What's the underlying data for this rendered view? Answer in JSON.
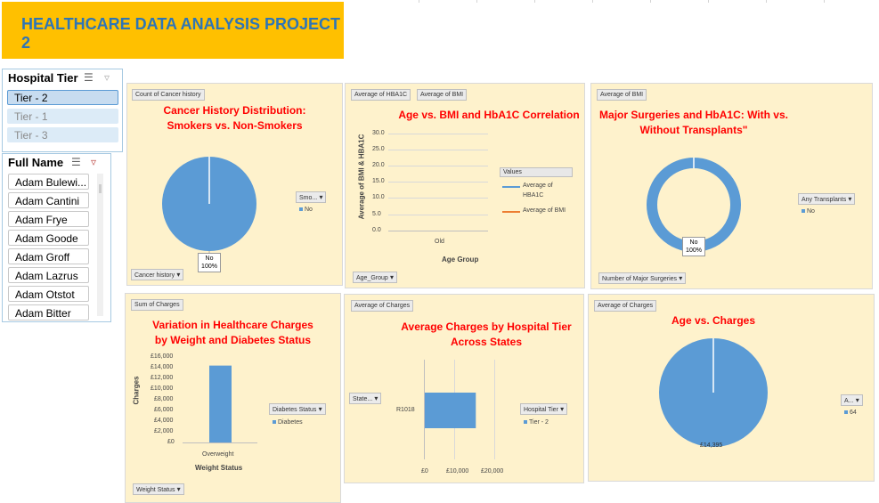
{
  "header": {
    "title": "HEALTHCARE DATA ANALYSIS PROJECT 2"
  },
  "hospital_tier_slicer": {
    "title": "Hospital Tier",
    "items": [
      "Tier - 2",
      "Tier - 1",
      "Tier - 3"
    ],
    "selected": "Tier - 2"
  },
  "full_name_slicer": {
    "title": "Full Name",
    "items": [
      "Adam Bulewi...",
      "Adam Cantini",
      "Adam Frye",
      "Adam Goode",
      "Adam Groff",
      "Adam Lazrus",
      "Adam Otstot",
      "Adam Bitter"
    ]
  },
  "charts": {
    "cancer": {
      "field_button": "Count of Cancer history",
      "title_line1": "Cancer History Distribution:",
      "title_line2": "Smokers vs. Non-Smokers",
      "legend_title": "Smo...",
      "legend_item": "No",
      "data_label_name": "No",
      "data_label_pct": "100%",
      "axis_button": "Cancer history"
    },
    "age_bmi": {
      "field_button_1": "Average of HBA1C",
      "field_button_2": "Average of BMI",
      "title": "Age vs. BMI and HbA1C Correlation",
      "y_axis_title": "Average of BMI & HBA1C",
      "y_ticks": [
        "30.0",
        "25.0",
        "20.0",
        "15.0",
        "10.0",
        "5.0",
        "0.0"
      ],
      "x_tick": "Old",
      "x_axis_title": "Age Group",
      "legend_title": "Values",
      "legend_item_1a": "Average of",
      "legend_item_1b": "HBA1C",
      "legend_item_2": "Average of BMI",
      "axis_button": "Age_Group"
    },
    "surgeries": {
      "field_button": "Average of BMI",
      "title_line1": "Major Surgeries and HbA1C: With vs.",
      "title_line2": "Without Transplants\"",
      "legend_title": "Any Transplants",
      "legend_item": "No",
      "data_label_name": "No",
      "data_label_pct": "100%",
      "axis_button": "Number of Major Surgeries"
    },
    "charges_weight": {
      "field_button": "Sum of Charges",
      "title_line1": "Variation in Healthcare Charges",
      "title_line2": "by Weight and Diabetes Status",
      "y_axis_title": "Charges",
      "y_ticks": [
        "£16,000",
        "£14,000",
        "£12,000",
        "£10,000",
        "£8,000",
        "£6,000",
        "£4,000",
        "£2,000",
        "£0"
      ],
      "x_tick": "Overweight",
      "x_axis_title": "Weight Status",
      "legend_title": "Diabetes Status",
      "legend_item": "Diabetes",
      "axis_button": "Weight Status"
    },
    "charges_tier": {
      "field_button": "Average of Charges",
      "title_line1": "Average Charges by Hospital Tier",
      "title_line2": "Across States",
      "row_button": "State...",
      "y_tick": "R1018",
      "x_ticks": [
        "£0",
        "£10,000",
        "£20,000"
      ],
      "legend_title": "Hospital Tier",
      "legend_item": "Tier - 2"
    },
    "age_charges": {
      "field_button": "Average of Charges",
      "title": "Age vs. Charges",
      "legend_title": "A...",
      "legend_item": "64",
      "data_label": "£14,395"
    }
  },
  "chart_data": [
    {
      "type": "pie",
      "title": "Cancer History Distribution: Smokers vs. Non-Smokers",
      "categories": [
        "No"
      ],
      "values": [
        100
      ],
      "unit": "%"
    },
    {
      "type": "line",
      "title": "Age vs. BMI and HbA1C Correlation",
      "categories": [
        "Old"
      ],
      "ylabel": "Average of BMI & HBA1C",
      "xlabel": "Age Group",
      "ylim": [
        0,
        30
      ],
      "series": [
        {
          "name": "Average of HBA1C",
          "color": "#5b9bd5"
        },
        {
          "name": "Average of BMI",
          "color": "#ed7d31"
        }
      ]
    },
    {
      "type": "pie",
      "title": "Major Surgeries and HbA1C: With vs. Without Transplants\"",
      "categories": [
        "No"
      ],
      "values": [
        100
      ],
      "unit": "%",
      "doughnut": true
    },
    {
      "type": "bar",
      "title": "Variation in Healthcare Charges by Weight and Diabetes Status",
      "categories": [
        "Overweight"
      ],
      "xlabel": "Weight Status",
      "ylabel": "Charges",
      "ylim": [
        0,
        16000
      ],
      "series": [
        {
          "name": "Diabetes",
          "values": [
            14395
          ]
        }
      ]
    },
    {
      "type": "bar",
      "orientation": "horizontal",
      "title": "Average Charges by Hospital Tier Across States",
      "categories": [
        "R1018"
      ],
      "xlim": [
        0,
        20000
      ],
      "series": [
        {
          "name": "Tier - 2",
          "values": [
            10000
          ]
        }
      ]
    },
    {
      "type": "pie",
      "title": "Age vs. Charges",
      "categories": [
        "64"
      ],
      "values": [
        14395
      ]
    }
  ],
  "colors": {
    "banner": "#ffc000",
    "banner_text": "#2e75b6",
    "panel": "#fef2cc",
    "series_blue": "#5b9bd5",
    "series_orange": "#ed7d31",
    "title_red": "#ff0000"
  }
}
